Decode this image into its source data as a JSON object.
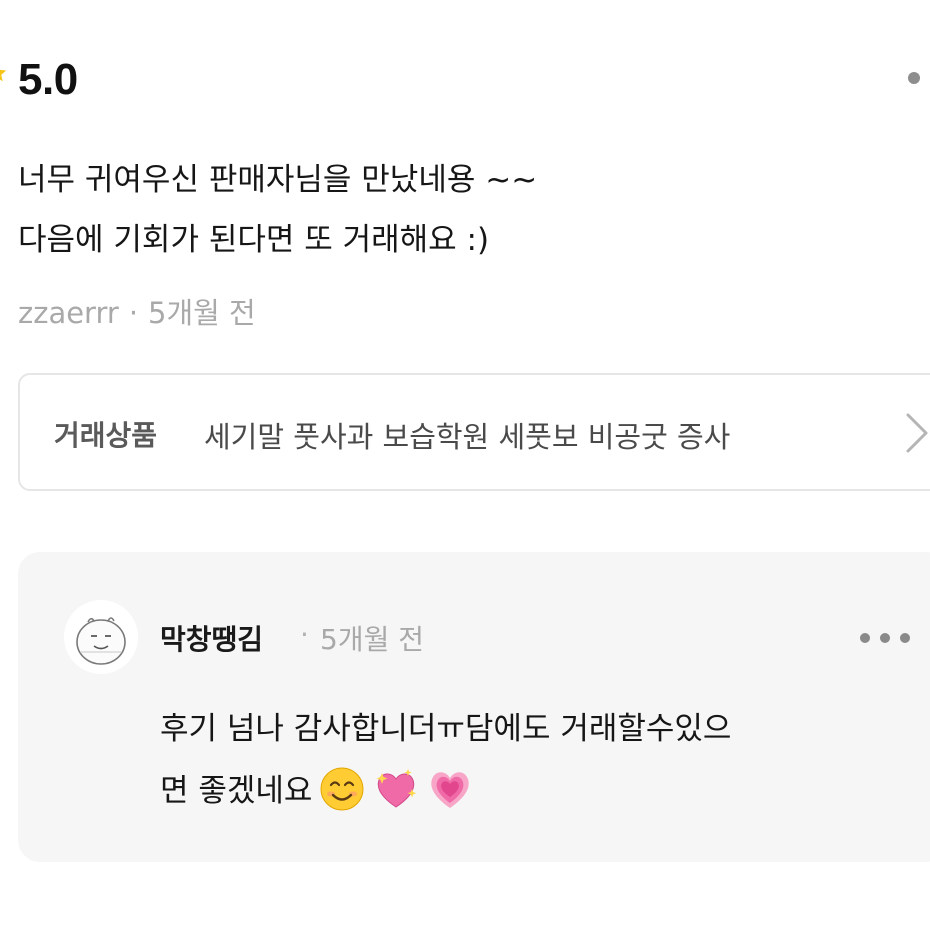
{
  "review": {
    "rating": "5.0",
    "lines": [
      "너무 귀여우신 판매자님을 만났네용 ~~",
      "다음에 기회가 된다면 또 거래해요 :)"
    ],
    "author": "zzaerrr",
    "separator": "·",
    "time": "5개월 전"
  },
  "product": {
    "label": "거래상품",
    "name": "세기말 풋사과 보습학원 세풋보 비공굿 증사"
  },
  "reply": {
    "author": "막창땡김",
    "separator": "·",
    "time": "5개월 전",
    "lines": [
      "후기 넘나 감사합니더ㅠ담에도 거래할수있으",
      "면 좋겠네요"
    ],
    "emojis": [
      "smiling-face-icon",
      "sparkling-heart-icon",
      "growing-heart-icon"
    ]
  },
  "colors": {
    "star": "#f5c518",
    "meta_gray": "#a9a9a9",
    "reply_bg": "#f6f6f6",
    "heart_pink": "#f06aa8"
  }
}
